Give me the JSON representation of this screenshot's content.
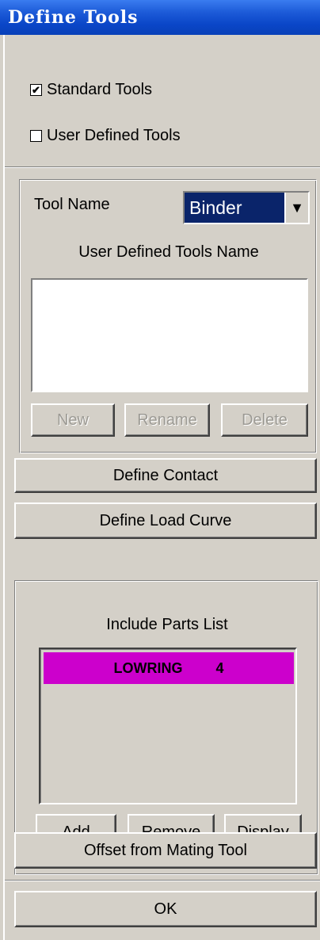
{
  "window": {
    "title": "Define Tools"
  },
  "tools": {
    "standard_label": "Standard Tools",
    "standard_checked": true,
    "user_defined_label": "User Defined Tools",
    "user_defined_checked": false
  },
  "tool_group": {
    "tool_name_label": "Tool Name",
    "tool_name_value": "Binder",
    "list_header": "User Defined Tools Name",
    "new_button": "New",
    "rename_button": "Rename",
    "delete_button": "Delete"
  },
  "actions": {
    "define_contact": "Define Contact",
    "define_load_curve": "Define Load Curve"
  },
  "parts_group": {
    "header": "Include Parts List",
    "parts": [
      {
        "name": "LOWRING",
        "id": "4"
      }
    ],
    "selected_color": "#cc00cc",
    "add_button": "Add",
    "remove_button": "Remove",
    "display_button": "Display"
  },
  "offset_button": "Offset from Mating Tool",
  "ok_button": "OK"
}
